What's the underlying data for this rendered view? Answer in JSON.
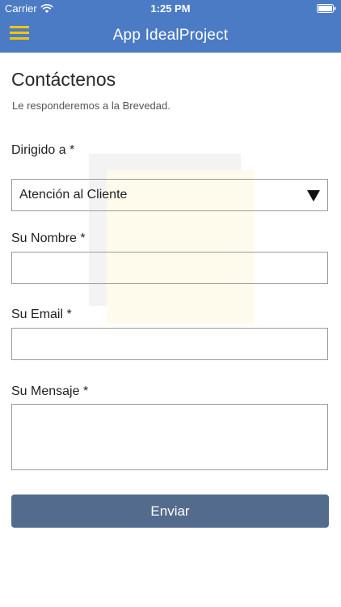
{
  "status_bar": {
    "carrier": "Carrier",
    "time": "1:25 PM",
    "wifi_icon": "wifi-icon",
    "battery_icon": "battery-icon"
  },
  "nav": {
    "title": "App IdealProject",
    "menu_icon": "hamburger-menu-icon",
    "background_color": "#4b7bc5",
    "menu_icon_color": "#f2c500"
  },
  "page": {
    "title": "Contáctenos",
    "subtitle": "Le responderemos a la Brevedad."
  },
  "form": {
    "recipient_label": "Dirigido a *",
    "recipient_value": "Atención al Cliente",
    "name_label": "Su Nombre *",
    "name_value": "",
    "email_label": "Su Email *",
    "email_value": "",
    "message_label": "Su Mensaje *",
    "message_value": "",
    "submit_label": "Enviar",
    "submit_color": "#536b8d"
  }
}
